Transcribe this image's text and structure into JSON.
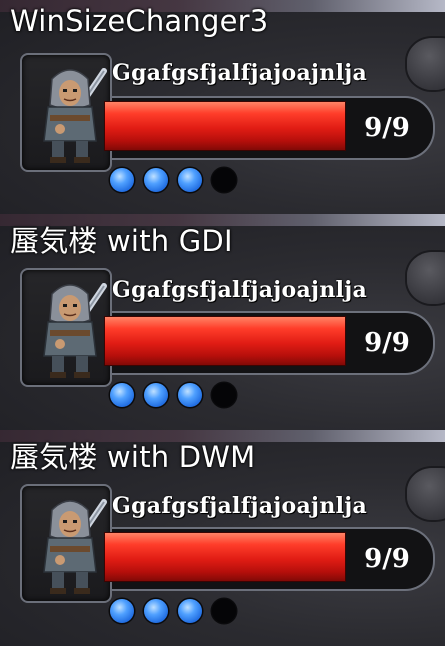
{
  "panels": [
    {
      "caption": "WinSizeChanger3",
      "name": "Ggafgsfjalfjajoajnlja",
      "hp": "9/9",
      "hp_fraction": 1.0,
      "charges": [
        true,
        true,
        true,
        false
      ]
    },
    {
      "caption": "蜃気楼 with GDI",
      "name": "Ggafgsfjalfjajoajnlja",
      "hp": "9/9",
      "hp_fraction": 1.0,
      "charges": [
        true,
        true,
        true,
        false
      ]
    },
    {
      "caption": "蜃気楼 with DWM",
      "name": "Ggafgsfjalfjajoajnlja",
      "hp": "9/9",
      "hp_fraction": 1.0,
      "charges": [
        true,
        true,
        true,
        false
      ]
    }
  ],
  "colors": {
    "hp_red": "#e01c14",
    "charge_blue": "#1f6be0",
    "frame_border": "#6b6f7a"
  },
  "icons": {
    "portrait": "hooded-swordsman-icon",
    "rock": "rock-icon"
  }
}
